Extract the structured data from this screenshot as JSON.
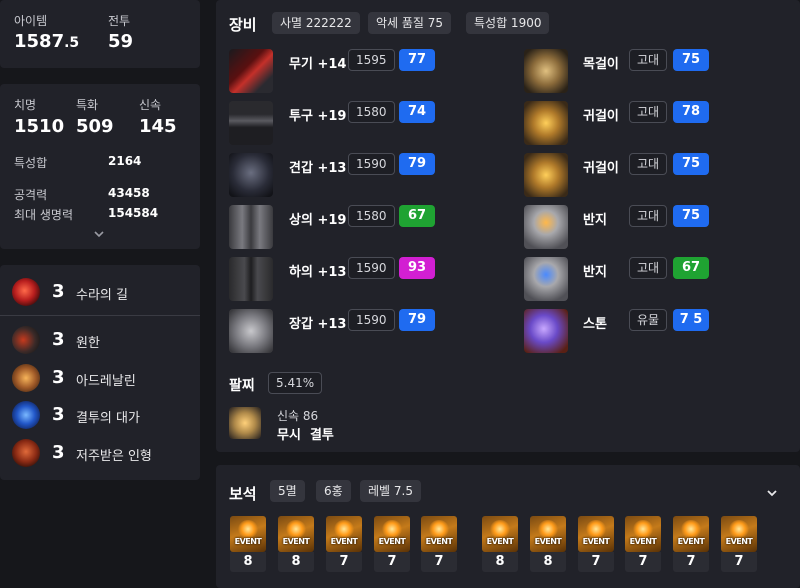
{
  "summary": {
    "item_level_label": "아이템",
    "item_level_main": "1587",
    "item_level_dec": ".5",
    "combat_label": "전투",
    "combat_value": "59"
  },
  "stats": {
    "crit_label": "치명",
    "crit_value": "1510",
    "spec_label": "특화",
    "spec_value": "509",
    "swift_label": "신속",
    "swift_value": "145",
    "total_label": "특성합",
    "total_value": "2164",
    "atk_label": "공격력",
    "atk_value": "43458",
    "hp_label": "최대 생명력",
    "hp_value": "154584"
  },
  "engravings": [
    {
      "level": "3",
      "name": "수라의 길"
    },
    {
      "level": "3",
      "name": "원한"
    },
    {
      "level": "3",
      "name": "아드레날린"
    },
    {
      "level": "3",
      "name": "결투의 대가"
    },
    {
      "level": "3",
      "name": "저주받은 인형"
    }
  ],
  "equipment": {
    "title": "장비",
    "chips": [
      "사멸 222222",
      "악세 품질 75",
      "특성합 1900"
    ],
    "armor": [
      {
        "name": "무기 +14",
        "ilvl": "1595",
        "quality": "77",
        "qcolor": "blue"
      },
      {
        "name": "투구 +19",
        "ilvl": "1580",
        "quality": "74",
        "qcolor": "blue"
      },
      {
        "name": "견갑 +13",
        "ilvl": "1590",
        "quality": "79",
        "qcolor": "blue"
      },
      {
        "name": "상의 +19",
        "ilvl": "1580",
        "quality": "67",
        "qcolor": "green"
      },
      {
        "name": "하의 +13",
        "ilvl": "1590",
        "quality": "93",
        "qcolor": "purple"
      },
      {
        "name": "장갑 +13",
        "ilvl": "1590",
        "quality": "79",
        "qcolor": "blue"
      }
    ],
    "accessories": [
      {
        "name": "목걸이",
        "grade": "고대",
        "quality": "75",
        "qcolor": "blue"
      },
      {
        "name": "귀걸이",
        "grade": "고대",
        "quality": "78",
        "qcolor": "blue"
      },
      {
        "name": "귀걸이",
        "grade": "고대",
        "quality": "75",
        "qcolor": "blue"
      },
      {
        "name": "반지",
        "grade": "고대",
        "quality": "75",
        "qcolor": "blue"
      },
      {
        "name": "반지",
        "grade": "고대",
        "quality": "67",
        "qcolor": "green"
      },
      {
        "name": "스톤",
        "grade": "유물",
        "quality": "7 5",
        "qcolor": "blue"
      }
    ],
    "bracelet": {
      "title": "팔찌",
      "percent": "5.41%",
      "line1": "신속 86",
      "line2": "무시  결투"
    }
  },
  "gems": {
    "title": "보석",
    "chips": [
      "5멸",
      "6홍",
      "레벨 7.5"
    ],
    "event_label": "EVENT",
    "levels": [
      "8",
      "8",
      "7",
      "7",
      "7",
      "8",
      "8",
      "7",
      "7",
      "7",
      "7"
    ]
  }
}
